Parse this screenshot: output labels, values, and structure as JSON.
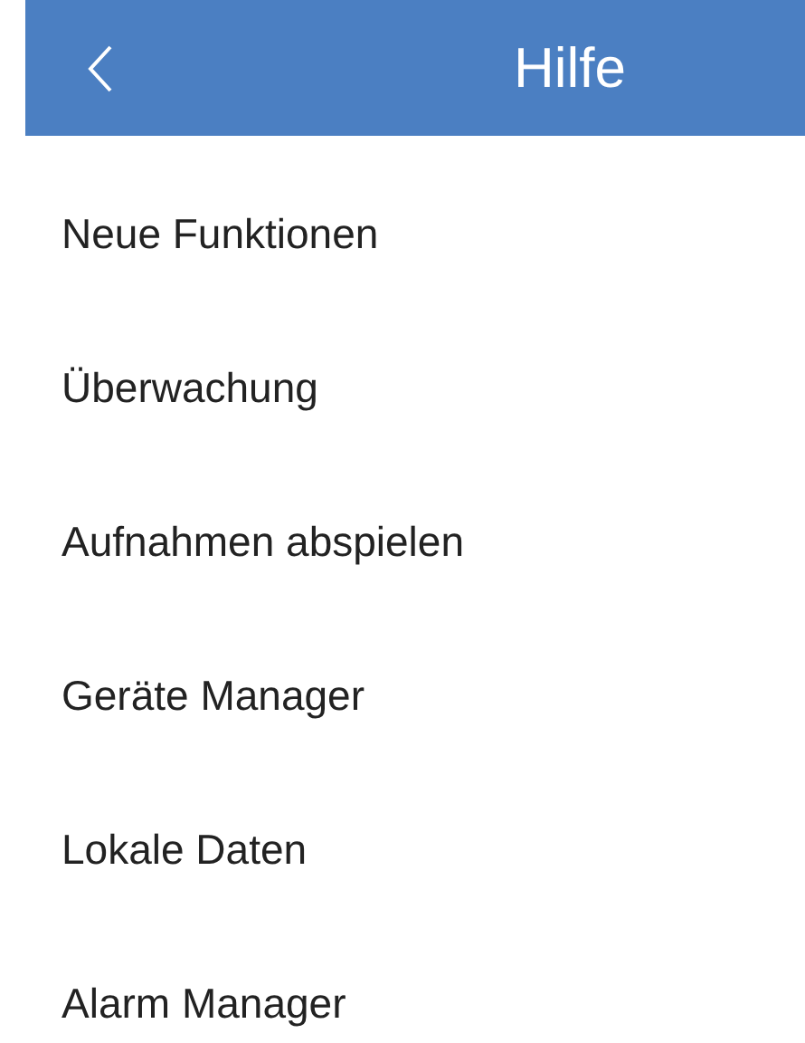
{
  "header": {
    "title": "Hilfe"
  },
  "menu_items": [
    {
      "label": "Neue Funktionen"
    },
    {
      "label": "Überwachung"
    },
    {
      "label": "Aufnahmen abspielen"
    },
    {
      "label": "Geräte Manager"
    },
    {
      "label": "Lokale Daten"
    },
    {
      "label": "Alarm Manager"
    }
  ]
}
